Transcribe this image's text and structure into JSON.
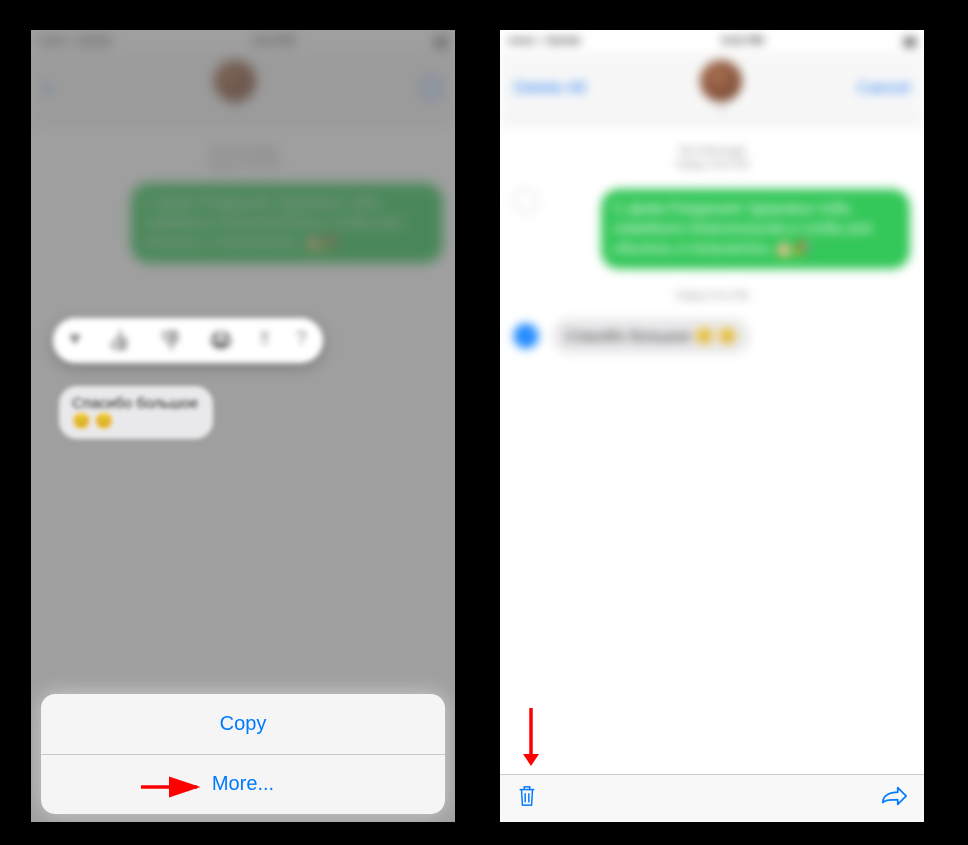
{
  "status": {
    "carrier": "Carrier",
    "time": "9:41 PM",
    "battery": "100%"
  },
  "left": {
    "contact_name": "—",
    "timestamp_line1": "Text Message",
    "timestamp_line2": "Today 9:40 PM",
    "sent_message": "С Днём Рождения! Здоровья тебе, семейного благополучия и чтобы всё сбылось и получилось 🎂🎉",
    "recv_message": "Спасибо большое 😊 😊",
    "tapbacks": [
      "♥",
      "👍",
      "👎",
      "😂",
      "‼",
      "?"
    ],
    "action_copy": "Copy",
    "action_more": "More..."
  },
  "right": {
    "nav_delete_all": "Delete All",
    "nav_cancel": "Cancel",
    "contact_name": "—",
    "timestamp_line1": "Text Message",
    "timestamp_line2": "Today 9:40 PM",
    "sent_message": "С Днём Рождения! Здоровья тебе, семейного благополучия и чтобы всё сбылось и получилось 🎂🎉",
    "recv_timestamp": "Today 9:41 PM",
    "recv_message": "Спасибо большое 😊 😊"
  },
  "colors": {
    "ios_blue": "#007aff",
    "ios_green": "#34c759",
    "arrow_red": "#ff0000"
  }
}
